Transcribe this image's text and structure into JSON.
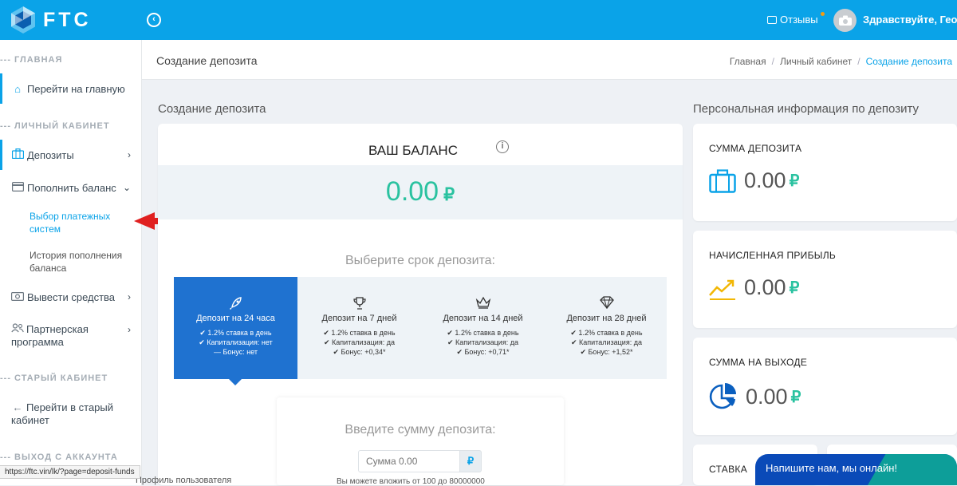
{
  "header": {
    "logo_text": "FTC",
    "reviews_label": "Отзывы",
    "greeting": "Здравствуйте, Георгий",
    "accent_color": "#0aa3e8"
  },
  "sidebar": {
    "sections": {
      "main": "--- ГЛАВНАЯ",
      "cabinet": "--- ЛИЧНЫЙ КАБИНЕТ",
      "old": "--- СТАРЫЙ КАБИНЕТ",
      "logout": "--- ВЫХОД С АККАУНТА"
    },
    "items": {
      "home": "Перейти на главную",
      "deposits": "Депозиты",
      "topup": "Пополнить баланс",
      "payment_systems": "Выбор платежных систем",
      "topup_history": "История пополнения баланса",
      "withdraw": "Вывести средства",
      "partner": "Партнерская программа",
      "old_cabinet": "Перейти в старый кабинет"
    },
    "icons": {
      "home": "home-icon",
      "deposits": "briefcase-icon",
      "topup": "card-icon",
      "withdraw": "cash-icon",
      "partner": "users-icon",
      "old_cabinet": "arrow-left-icon"
    }
  },
  "page": {
    "title": "Создание депозита",
    "breadcrumb": [
      "Главная",
      "Личный кабинет",
      "Создание депозита"
    ]
  },
  "left_col": {
    "title": "Создание депозита",
    "balance_title": "ВАШ БАЛАНС",
    "balance_value": "0.00",
    "currency": "₽",
    "choose_term": "Выберите срок депозита:",
    "terms": [
      {
        "title": "Депозит на 24 часа",
        "icon": "rocket-icon",
        "lines": [
          "✔ 1.2% ставка в день",
          "✔ Капитализация: нет",
          "— Бонус: нет"
        ],
        "active": true
      },
      {
        "title": "Депозит на 7 дней",
        "icon": "trophy-icon",
        "lines": [
          "✔ 1.2% ставка в день",
          "✔ Капитализация: да",
          "✔ Бонус: +0,34*"
        ],
        "active": false
      },
      {
        "title": "Депозит на 14 дней",
        "icon": "crown-icon",
        "lines": [
          "✔ 1.2% ставка в день",
          "✔ Капитализация: да",
          "✔ Бонус: +0,71*"
        ],
        "active": false
      },
      {
        "title": "Депозит на 28 дней",
        "icon": "diamond-icon",
        "lines": [
          "✔ 1.2% ставка в день",
          "✔ Капитализация: да",
          "✔ Бонус: +1,52*"
        ],
        "active": false
      }
    ],
    "enter_amount": "Введите сумму депозита:",
    "amount_placeholder": "Сумма 0.00",
    "amount_currency": "₽",
    "below_text": "Вы можете вложить от 100 до 80000000"
  },
  "right_col": {
    "title": "Персональная информация по депозиту",
    "stats": [
      {
        "label": "СУММА ДЕПОЗИТА",
        "value": "0.00",
        "icon": "briefcase-icon"
      },
      {
        "label": "НАЧИСЛЕННАЯ ПРИБЫЛЬ",
        "value": "0.00",
        "icon": "trend-up-icon"
      },
      {
        "label": "СУММА НА ВЫХОДЕ",
        "value": "0.00",
        "icon": "pie-chart-icon"
      }
    ],
    "rate_label": "СТАВКА"
  },
  "status_bar": {
    "url": "https://ftc.vin/lk/?page=deposit-funds"
  },
  "profile_link": "Профиль пользователя",
  "chat_widget": {
    "label": "Напишите нам, мы онлайн!"
  }
}
